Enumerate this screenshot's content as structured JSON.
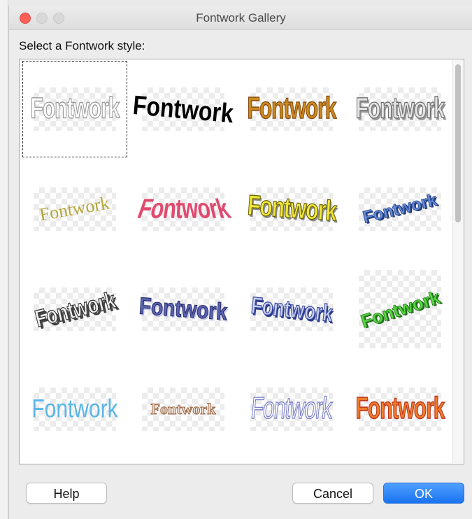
{
  "window": {
    "title": "Fontwork Gallery",
    "prompt": "Select a Fontwork style:"
  },
  "gallery": {
    "items": [
      {
        "text": "Fontwork",
        "style": "outline-white",
        "selected": true
      },
      {
        "text": "Fontwork",
        "style": "black-wave"
      },
      {
        "text": "Fontwork",
        "style": "gold-gradient"
      },
      {
        "text": "Fontwork",
        "style": "silver-3d"
      },
      {
        "text": "Fontwork",
        "style": "olive-serif-arc"
      },
      {
        "text": "Fontwork",
        "style": "red-perspective"
      },
      {
        "text": "Fontwork",
        "style": "yellow-3d"
      },
      {
        "text": "Fontwork",
        "style": "blue-3d-rising"
      },
      {
        "text": "Fontwork",
        "style": "gray-3d-rising"
      },
      {
        "text": "Fontwork",
        "style": "purple-blue-wave"
      },
      {
        "text": "Fontwork",
        "style": "blue-3d-wave"
      },
      {
        "text": "Fontwork",
        "style": "green-arc"
      },
      {
        "text": "Fontwork",
        "style": "light-blue-wave"
      },
      {
        "text": "Fontwork",
        "style": "brown-arc-outline"
      },
      {
        "text": "Fontwork",
        "style": "lavender-outline"
      },
      {
        "text": "Fontwork",
        "style": "orange-red-gradient"
      }
    ]
  },
  "buttons": {
    "help": "Help",
    "cancel": "Cancel",
    "ok": "OK"
  },
  "colors": {
    "accent": "#1a73f0",
    "close": "#fe5f57"
  }
}
